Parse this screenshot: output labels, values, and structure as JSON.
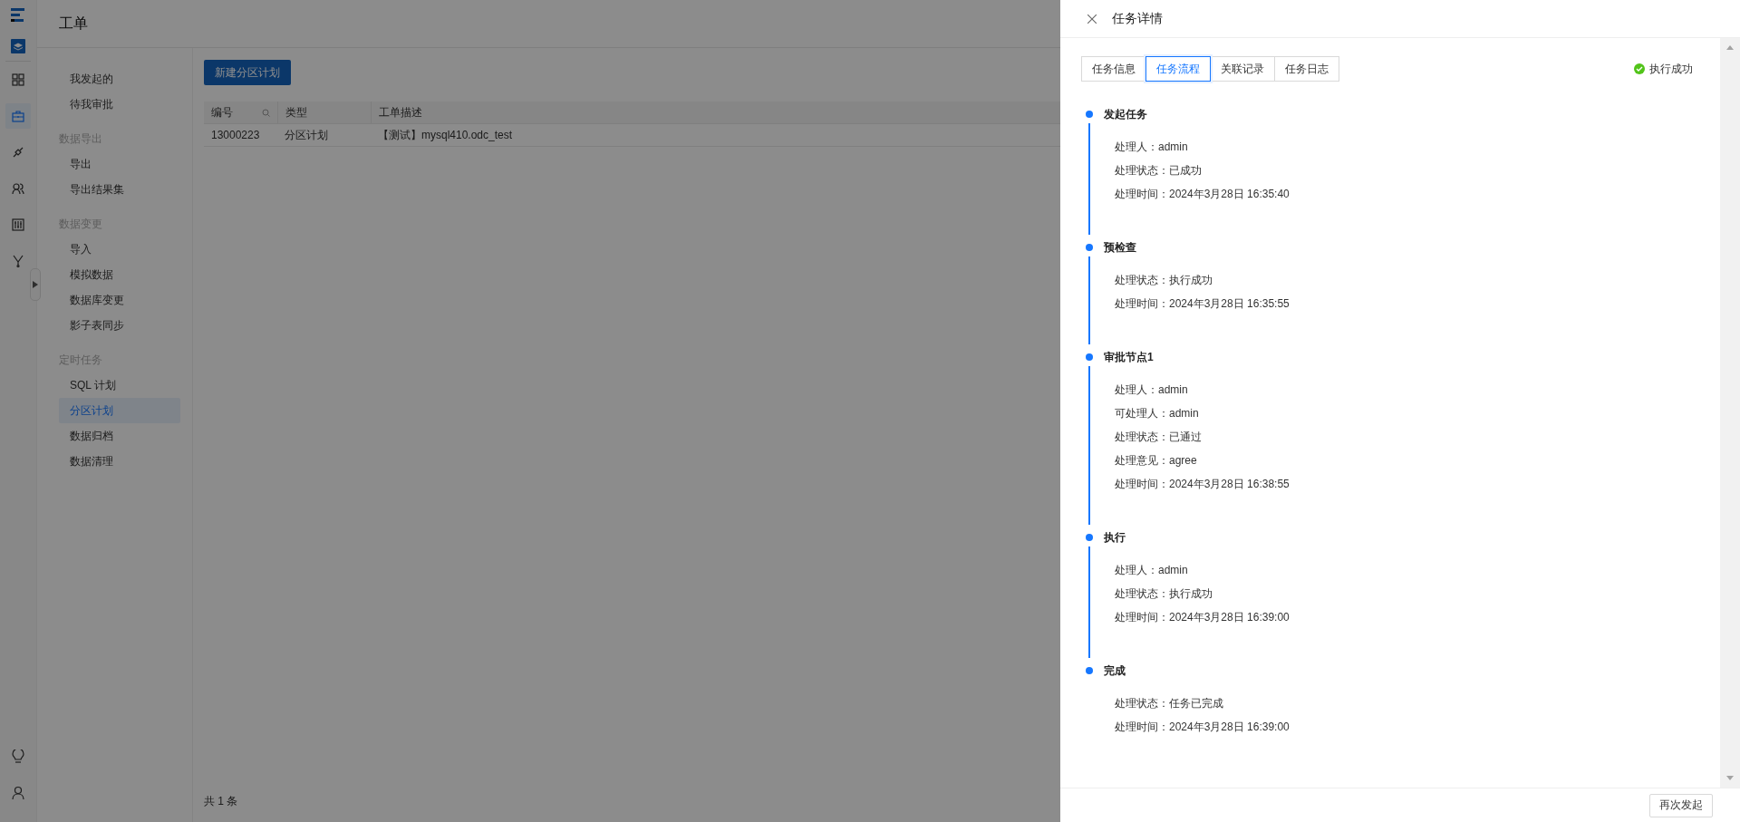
{
  "rail": {
    "items": [
      {
        "selected": false
      },
      {
        "selected": true
      },
      {
        "selected": false
      },
      {
        "selected": false
      },
      {
        "selected": false
      },
      {
        "selected": false
      }
    ]
  },
  "page": {
    "title": "工单"
  },
  "nav": {
    "groups": [
      {
        "items": [
          {
            "label": "我发起的",
            "selected": false
          },
          {
            "label": "待我审批",
            "selected": false
          }
        ]
      },
      {
        "title": "数据导出",
        "items": [
          {
            "label": "导出",
            "selected": false
          },
          {
            "label": "导出结果集",
            "selected": false
          }
        ]
      },
      {
        "title": "数据变更",
        "items": [
          {
            "label": "导入",
            "selected": false
          },
          {
            "label": "模拟数据",
            "selected": false
          },
          {
            "label": "数据库变更",
            "selected": false
          },
          {
            "label": "影子表同步",
            "selected": false
          }
        ]
      },
      {
        "title": "定时任务",
        "items": [
          {
            "label": "SQL 计划",
            "selected": false
          },
          {
            "label": "分区计划",
            "selected": true
          },
          {
            "label": "数据归档",
            "selected": false
          },
          {
            "label": "数据清理",
            "selected": false
          }
        ]
      }
    ]
  },
  "toolbar": {
    "new_button": "新建分区计划"
  },
  "table": {
    "columns": [
      "编号",
      "类型",
      "工单描述"
    ],
    "rows": [
      [
        "13000223",
        "分区计划",
        "【测试】mysql410.odc_test"
      ]
    ]
  },
  "pagination": {
    "total": "共 1 条"
  },
  "drawer": {
    "title": "任务详情",
    "tabs": [
      {
        "label": "任务信息",
        "selected": false
      },
      {
        "label": "任务流程",
        "selected": true
      },
      {
        "label": "关联记录",
        "selected": false
      },
      {
        "label": "任务日志",
        "selected": false
      }
    ],
    "status": {
      "text": "执行成功",
      "kind": "success"
    },
    "steps": [
      {
        "title": "发起任务",
        "lines": [
          "处理人：admin",
          "处理状态：已成功",
          "处理时间：2024年3月28日 16:35:40"
        ]
      },
      {
        "title": "预检查",
        "lines": [
          "处理状态：执行成功",
          "处理时间：2024年3月28日 16:35:55"
        ]
      },
      {
        "title": "审批节点1",
        "lines": [
          "处理人：admin",
          "可处理人：admin",
          "处理状态：已通过",
          "处理意见：agree",
          "处理时间：2024年3月28日 16:38:55"
        ]
      },
      {
        "title": "执行",
        "lines": [
          "处理人：admin",
          "处理状态：执行成功",
          "处理时间：2024年3月28日 16:39:00"
        ]
      },
      {
        "title": "完成",
        "lines": [
          "处理状态：任务已完成",
          "处理时间：2024年3月28日 16:39:00"
        ]
      }
    ],
    "footer_button": "再次发起"
  }
}
